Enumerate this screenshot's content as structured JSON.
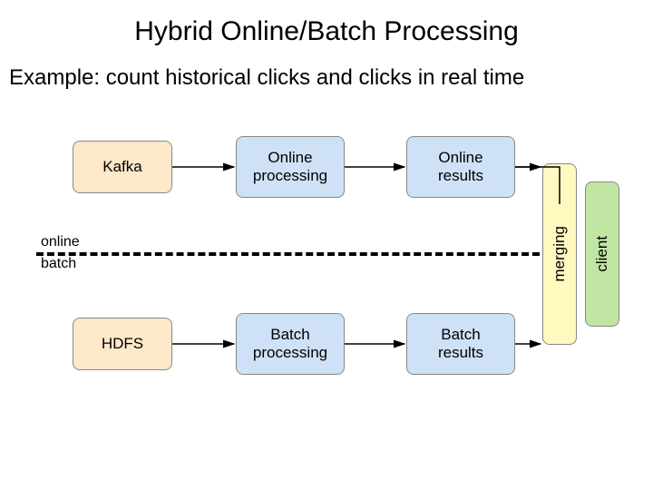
{
  "title": "Hybrid Online/Batch Processing",
  "subtitle": "Example: count historical clicks and clicks in real time",
  "lanes": {
    "online": "online",
    "batch": "batch"
  },
  "nodes": {
    "kafka": "Kafka",
    "online_processing": "Online\nprocessing",
    "online_results": "Online\nresults",
    "hdfs": "HDFS",
    "batch_processing": "Batch\nprocessing",
    "batch_results": "Batch\nresults",
    "merging": "merging",
    "client": "client"
  }
}
